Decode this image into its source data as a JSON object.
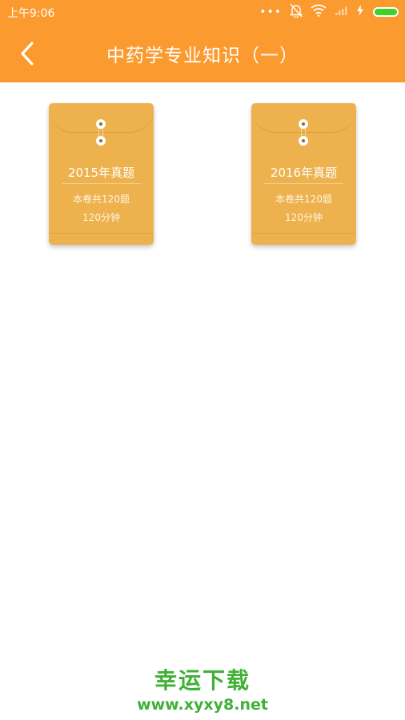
{
  "status_bar": {
    "time": "上午9:06",
    "dots": "•••",
    "battery_color": "#3dd42a"
  },
  "header": {
    "title": "中药学专业知识（一）",
    "background": "#fb9a2e"
  },
  "papers": [
    {
      "title": "2015年真题",
      "question_count": "本卷共120题",
      "duration": "120分钟"
    },
    {
      "title": "2016年真题",
      "question_count": "本卷共120题",
      "duration": "120分钟"
    }
  ],
  "watermark": {
    "brand": "幸运下载",
    "url": "www.xyxy8.net"
  }
}
